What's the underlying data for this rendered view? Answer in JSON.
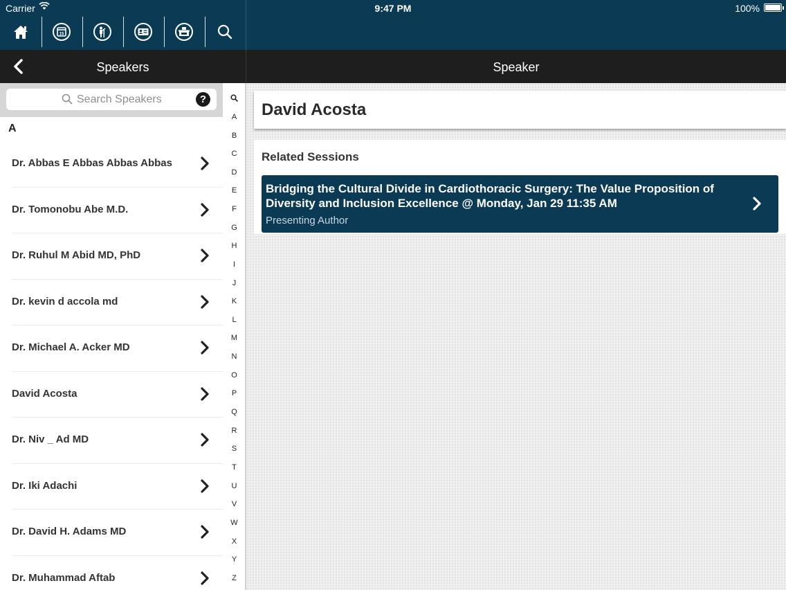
{
  "status": {
    "carrier": "Carrier",
    "time": "9:47 PM",
    "battery": "100%"
  },
  "toolbar": {
    "icons": [
      "home-icon",
      "calendar-icon",
      "presenter-icon",
      "attendee-card-icon",
      "exhibitor-booth-icon",
      "search-icon"
    ]
  },
  "nav_left": {
    "title": "Speakers"
  },
  "nav_right": {
    "title": "Speaker"
  },
  "search": {
    "placeholder": "Search Speakers",
    "help": "?"
  },
  "list": {
    "section": "A",
    "items": [
      "Dr. Abbas E Abbas Abbas Abbas",
      "Dr. Tomonobu Abe M.D.",
      "Dr. Ruhul M Abid MD, PhD",
      "Dr. kevin d accola md",
      "Dr. Michael A. Acker MD",
      "David Acosta",
      "Dr. Niv _ Ad MD",
      "Dr. Iki Adachi",
      "Dr. David H. Adams MD",
      "Dr. Muhammad Aftab"
    ]
  },
  "index": [
    "Q",
    "A",
    "B",
    "C",
    "D",
    "E",
    "F",
    "G",
    "H",
    "I",
    "J",
    "K",
    "L",
    "M",
    "N",
    "O",
    "P",
    "Q",
    "R",
    "S",
    "T",
    "U",
    "V",
    "W",
    "X",
    "Y",
    "Z"
  ],
  "detail": {
    "name": "David Acosta",
    "related_header": "Related Sessions",
    "session": {
      "title": "Bridging the Cultural Divide in Cardiothoracic Surgery: The Value Proposition of Diversity and Inclusion Excellence @ Monday, Jan 29 11:35 AM",
      "role": "Presenting Author"
    }
  },
  "colors": {
    "primary": "#0b3a55",
    "navbar": "#1e1e1e"
  }
}
